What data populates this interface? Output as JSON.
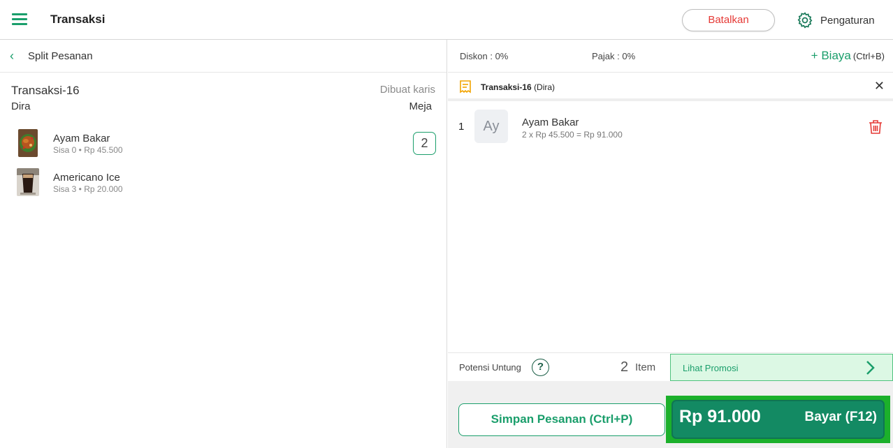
{
  "header": {
    "title": "Transaksi",
    "cancel_label": "Batalkan",
    "settings_label": "Pengaturan"
  },
  "left": {
    "subheader_title": "Split Pesanan",
    "transaction_name": "Transaksi-16",
    "creator": "Dibuat karis",
    "customer": "Dira",
    "table": "Meja",
    "items": [
      {
        "name": "Ayam Bakar",
        "detail": "Sisa 0 • Rp 45.500",
        "quantity": "2",
        "thumbnail": "grilled-chicken-photo"
      },
      {
        "name": "Americano Ice",
        "detail": "Sisa 3 • Rp 20.000",
        "thumbnail": "iced-coffee-photo"
      }
    ]
  },
  "right": {
    "discount": "Diskon : 0%",
    "tax": "Pajak : 0%",
    "fee_label": "+ Biaya",
    "fee_shortcut": "(Ctrl+B)",
    "tx_title": "Transaksi-16",
    "tx_customer": "(Dira)",
    "order": {
      "number": "1",
      "avatar": "Ay",
      "name": "Ayam Bakar",
      "calc": "2 x Rp 45.500 = Rp 91.000"
    },
    "potensi_label": "Potensi Untung",
    "help_symbol": "?",
    "item_count": "2",
    "item_count_label": "Item",
    "promo_label": "Lihat Promosi",
    "save_label": "Simpan Pesanan (Ctrl+P)",
    "pay_amount": "Rp 91.000",
    "pay_label": "Bayar (F12)"
  },
  "colors": {
    "brand_green": "#1a9e6b",
    "pay_button": "#138a63",
    "pay_highlight": "#1cb02b",
    "cancel_red": "#e53935",
    "promo_bg": "#dcf8e4"
  }
}
